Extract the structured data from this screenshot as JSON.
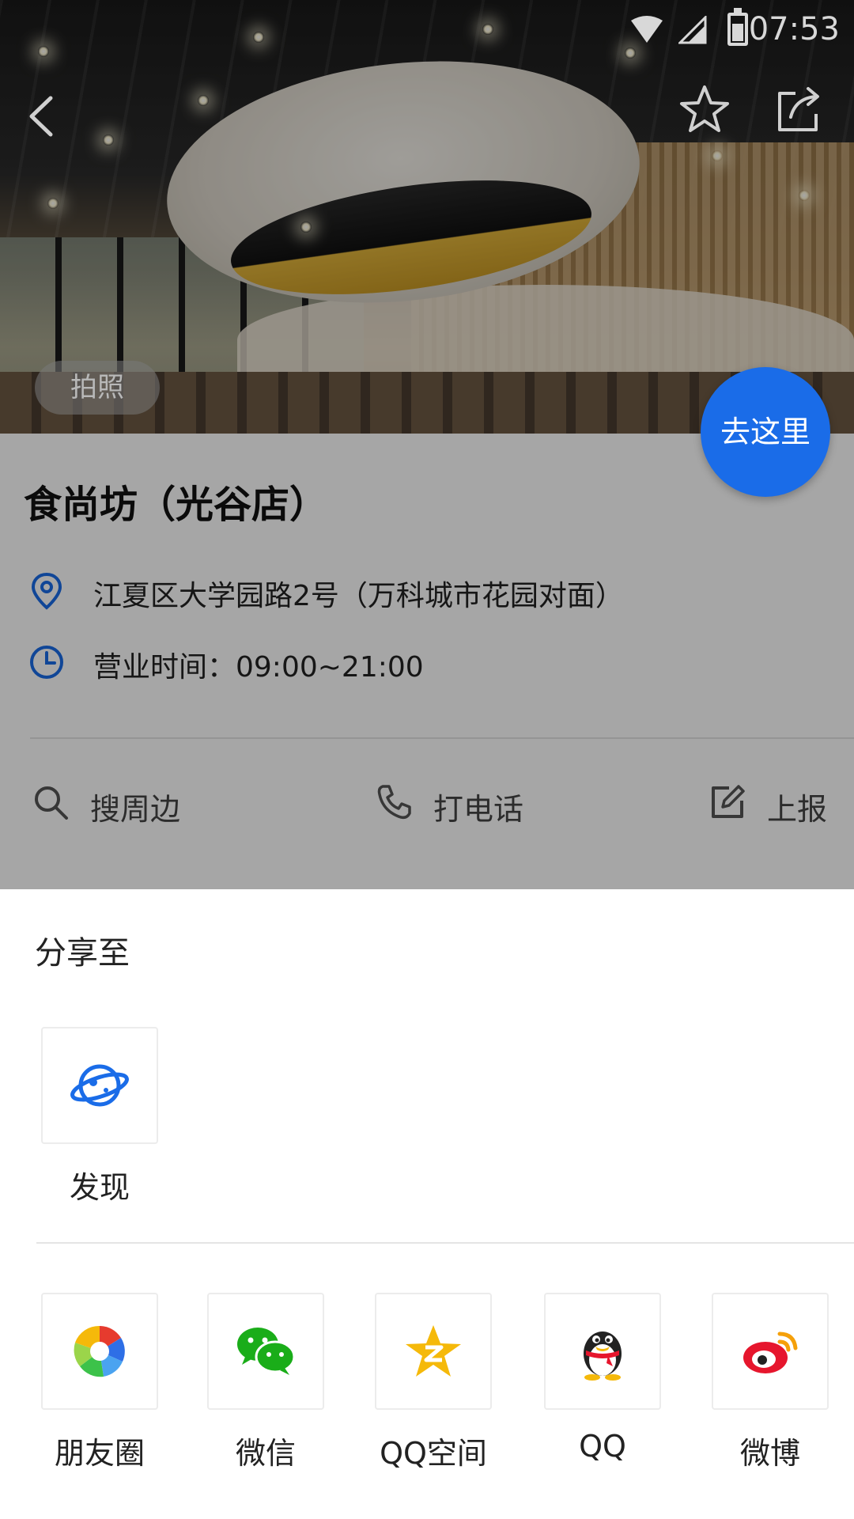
{
  "status_bar": {
    "time": "07:53"
  },
  "hero": {
    "photo_button_label": "拍照"
  },
  "place": {
    "name": "食尚坊（光谷店）",
    "address": "江夏区大学园路2号（万科城市花园对面）",
    "hours": "营业时间：09:00~21:00",
    "go_button_label": "去这里"
  },
  "actions": {
    "search_nearby": "搜周边",
    "call": "打电话",
    "report": "上报"
  },
  "share_sheet": {
    "title": "分享至",
    "primary": [
      {
        "label": "发现",
        "icon": "planet-icon"
      }
    ],
    "targets": [
      {
        "label": "朋友圈",
        "icon": "moments-icon"
      },
      {
        "label": "微信",
        "icon": "wechat-icon"
      },
      {
        "label": "QQ空间",
        "icon": "qzone-icon"
      },
      {
        "label": "QQ",
        "icon": "qq-icon"
      },
      {
        "label": "微博",
        "icon": "weibo-icon"
      }
    ]
  },
  "colors": {
    "accent_blue": "#1a6ce8",
    "wechat_green": "#1aad19",
    "qzone_yellow": "#f5b90a",
    "weibo_red": "#e6162d"
  }
}
